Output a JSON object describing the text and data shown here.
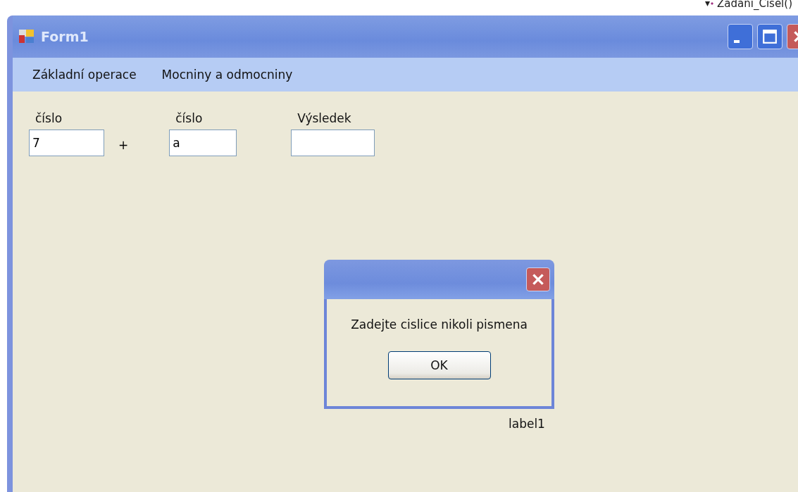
{
  "top_strip": {
    "text": "Zadani_Cisel()"
  },
  "window": {
    "title": "Form1"
  },
  "menu": [
    {
      "label": "Základní operace"
    },
    {
      "label": "Mocniny a odmocniny"
    }
  ],
  "fields": [
    {
      "label": "číslo",
      "value": "7"
    },
    {
      "label": "číslo",
      "value": "a"
    },
    {
      "label": "Výsledek"
    }
  ],
  "operator": "+",
  "status_label": "label1",
  "message_box": {
    "text": "Zadejte cislice nikoli pismena",
    "buttons": [
      "OK"
    ]
  }
}
